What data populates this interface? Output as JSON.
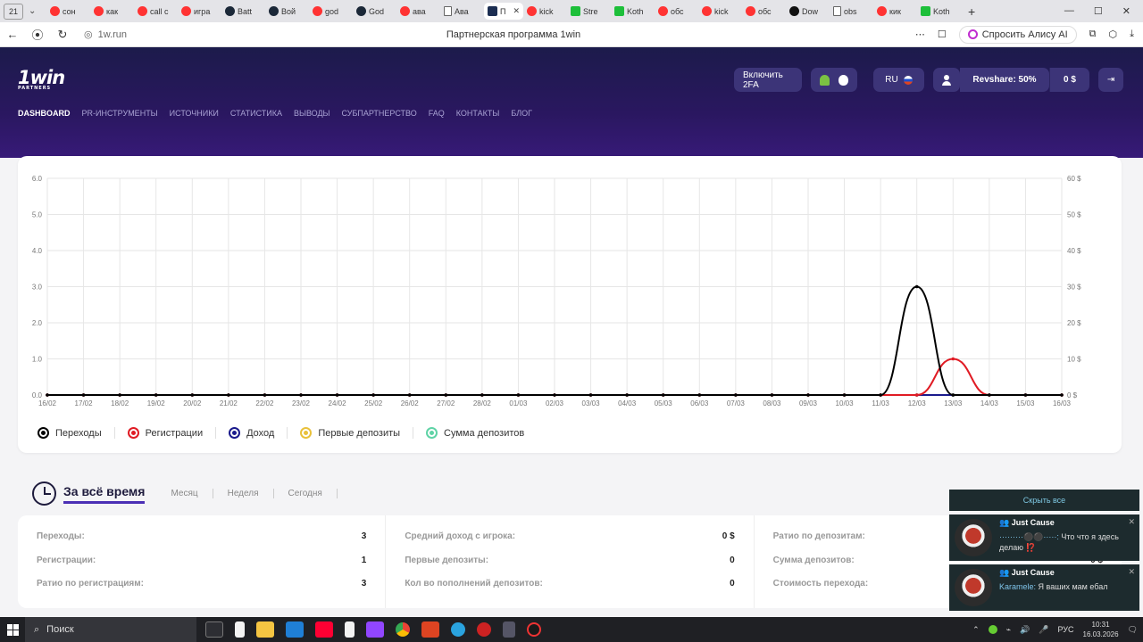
{
  "browser": {
    "tab_count": "21",
    "tabs": [
      {
        "title": "сон",
        "icon": "ya"
      },
      {
        "title": "как",
        "icon": "ya"
      },
      {
        "title": "call c",
        "icon": "ya"
      },
      {
        "title": "игра",
        "icon": "ya"
      },
      {
        "title": "Batt",
        "icon": "steam"
      },
      {
        "title": "Вой",
        "icon": "steam"
      },
      {
        "title": "god",
        "icon": "ya"
      },
      {
        "title": "God",
        "icon": "steam"
      },
      {
        "title": "ава",
        "icon": "ya"
      },
      {
        "title": "Ава",
        "icon": "doc"
      },
      {
        "title": "П",
        "icon": "onew",
        "active": true
      },
      {
        "title": "kick",
        "icon": "ya"
      },
      {
        "title": "Stre",
        "icon": "green"
      },
      {
        "title": "Koth",
        "icon": "green"
      },
      {
        "title": "обс",
        "icon": "ya"
      },
      {
        "title": "kick",
        "icon": "ya"
      },
      {
        "title": "обс",
        "icon": "ya"
      },
      {
        "title": "Dow",
        "icon": "black"
      },
      {
        "title": "obs",
        "icon": "doc"
      },
      {
        "title": "кик",
        "icon": "ya"
      },
      {
        "title": "Koth",
        "icon": "green"
      }
    ],
    "url": "1w.run",
    "page_title": "Партнерская программа 1win",
    "alice_label": "Спросить Алису AI"
  },
  "header": {
    "logo_text": "1win",
    "logo_sub": "PARTNERS",
    "nav": [
      "DASHBOARD",
      "PR-ИНСТРУМЕНТЫ",
      "ИСТОЧНИКИ",
      "СТАТИСТИКА",
      "ВЫВОДЫ",
      "СУБПАРТНЕРСТВО",
      "FAQ",
      "КОНТАКТЫ",
      "БЛОГ"
    ],
    "enable_2fa": "Включить 2FA",
    "lang": "RU",
    "revshare": "Revshare: 50%",
    "balance": "0 $"
  },
  "chart_data": {
    "type": "line",
    "x": [
      "16/02",
      "17/02",
      "18/02",
      "19/02",
      "20/02",
      "21/02",
      "22/02",
      "23/02",
      "24/02",
      "25/02",
      "26/02",
      "27/02",
      "28/02",
      "01/03",
      "02/03",
      "03/03",
      "04/03",
      "05/03",
      "06/03",
      "07/03",
      "08/03",
      "09/03",
      "10/03",
      "11/03",
      "12/03",
      "13/03",
      "14/03",
      "15/03",
      "16/03"
    ],
    "y_left_ticks": [
      "0.0",
      "1.0",
      "2.0",
      "3.0",
      "4.0",
      "5.0",
      "6.0"
    ],
    "y_right_ticks": [
      "0 $",
      "10 $",
      "20 $",
      "30 $",
      "40 $",
      "50 $",
      "60 $"
    ],
    "ylim": [
      0,
      6
    ],
    "ylim_right": [
      0,
      60
    ],
    "grid": true,
    "legend_position": "bottom-left",
    "series": [
      {
        "name": "Переходы",
        "color": "#000000",
        "values": [
          0,
          0,
          0,
          0,
          0,
          0,
          0,
          0,
          0,
          0,
          0,
          0,
          0,
          0,
          0,
          0,
          0,
          0,
          0,
          0,
          0,
          0,
          0,
          0,
          3,
          0,
          0,
          0,
          0
        ]
      },
      {
        "name": "Регистрации",
        "color": "#e01b24",
        "values": [
          0,
          0,
          0,
          0,
          0,
          0,
          0,
          0,
          0,
          0,
          0,
          0,
          0,
          0,
          0,
          0,
          0,
          0,
          0,
          0,
          0,
          0,
          0,
          0,
          0,
          1,
          0,
          0,
          0
        ]
      },
      {
        "name": "Доход",
        "color": "#1a1a8c",
        "values": [
          0,
          0,
          0,
          0,
          0,
          0,
          0,
          0,
          0,
          0,
          0,
          0,
          0,
          0,
          0,
          0,
          0,
          0,
          0,
          0,
          0,
          0,
          0,
          0,
          0,
          0,
          0,
          0,
          0
        ]
      },
      {
        "name": "Первые депозиты",
        "color": "#e9c13b",
        "values": [
          0,
          0,
          0,
          0,
          0,
          0,
          0,
          0,
          0,
          0,
          0,
          0,
          0,
          0,
          0,
          0,
          0,
          0,
          0,
          0,
          0,
          0,
          0,
          0,
          0,
          0,
          0,
          0,
          0
        ]
      },
      {
        "name": "Сумма депозитов",
        "color": "#5fd3a6",
        "values": [
          0,
          0,
          0,
          0,
          0,
          0,
          0,
          0,
          0,
          0,
          0,
          0,
          0,
          0,
          0,
          0,
          0,
          0,
          0,
          0,
          0,
          0,
          0,
          0,
          0,
          0,
          0,
          0,
          0
        ]
      }
    ]
  },
  "periods": {
    "active": "За всё время",
    "others": [
      "Месяц",
      "Неделя",
      "Сегодня"
    ]
  },
  "stats": {
    "col1": [
      {
        "label": "Переходы:",
        "value": "3"
      },
      {
        "label": "Регистрации:",
        "value": "1"
      },
      {
        "label": "Ратио по регистрациям:",
        "value": "3"
      }
    ],
    "col2": [
      {
        "label": "Средний доход с игрока:",
        "value": "0 $"
      },
      {
        "label": "Первые депозиты:",
        "value": "0"
      },
      {
        "label": "Кол во пополнений депозитов:",
        "value": "0"
      }
    ],
    "col3": [
      {
        "label": "Ратио по депозитам:",
        "value": ""
      },
      {
        "label": "Сумма депозитов:",
        "value": "0 $"
      },
      {
        "label": "Стоимость перехода:",
        "value": ""
      }
    ]
  },
  "notifications": {
    "hide_all": "Скрыть все",
    "items": [
      {
        "title": "Just Cause",
        "author": "",
        "message": "Что что я здесь делаю ⁉️"
      },
      {
        "title": "Just Cause",
        "author": "Karamele:",
        "message": "Я ваших мам ебал"
      }
    ]
  },
  "taskbar": {
    "search_label": "Поиск",
    "lang": "РУС",
    "time": "10:31",
    "date": "16.03.2026"
  }
}
